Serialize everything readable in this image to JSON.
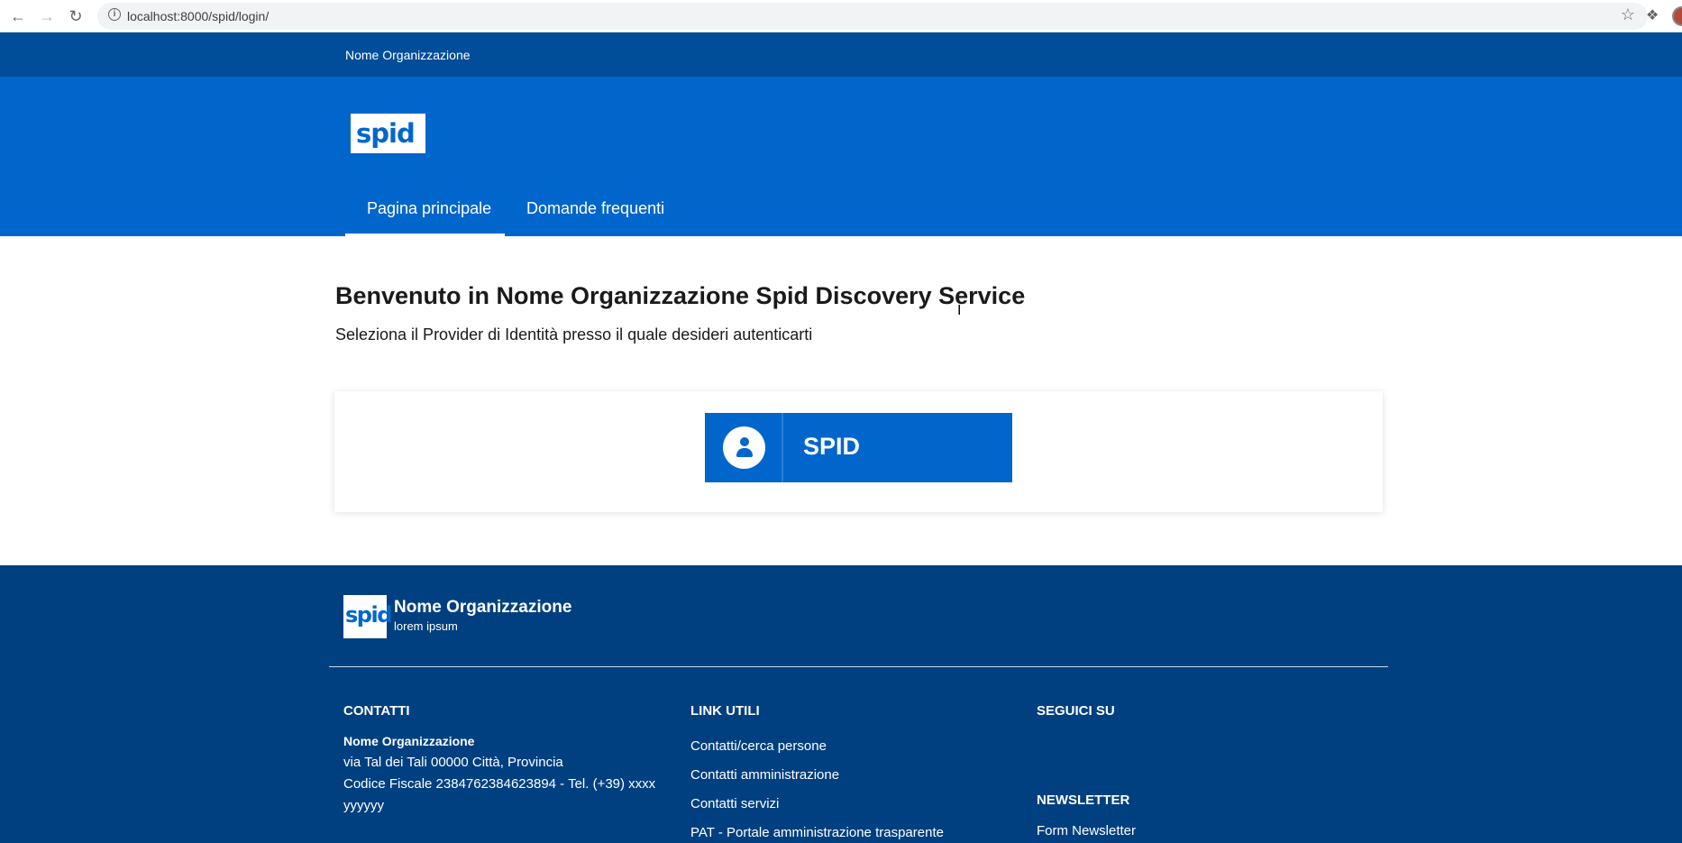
{
  "browser": {
    "url": "localhost:8000/spid/login/",
    "back_icon": "arrow-left-icon",
    "forward_icon": "arrow-right-icon",
    "reload_icon": "reload-icon"
  },
  "header": {
    "org_name": "Nome Organizzazione",
    "logo_text": "spid",
    "tabs": [
      {
        "label": "Pagina principale",
        "active": true
      },
      {
        "label": "Domande frequenti",
        "active": false
      }
    ]
  },
  "main": {
    "title": "Benvenuto in Nome Organizzazione Spid Discovery Service",
    "subtitle": "Seleziona il Provider di Identità presso il quale desideri autenticarti",
    "spid_button_label": "SPID"
  },
  "footer": {
    "logo_text": "spid",
    "org_name": "Nome Organizzazione",
    "org_sub": "lorem ipsum",
    "contacts": {
      "heading": "CONTATTI",
      "org": "Nome Organizzazione",
      "address": "via Tal dei Tali 00000 Città, Provincia",
      "fiscal": "Codice Fiscale 2384762384623894 - Tel. (+39) xxxx",
      "fiscal_cont": "yyyyyy"
    },
    "links": {
      "heading": "LINK UTILI",
      "items": [
        "Contatti/cerca persone",
        "Contatti amministrazione",
        "Contatti servizi",
        "PAT - Portale amministrazione trasparente"
      ]
    },
    "social": {
      "heading": "SEGUICI SU"
    },
    "newsletter": {
      "heading": "NEWSLETTER",
      "link": "Form Newsletter"
    }
  },
  "colors": {
    "slim_header": "#004d99",
    "main_header": "#0066cc",
    "footer": "#004080"
  }
}
